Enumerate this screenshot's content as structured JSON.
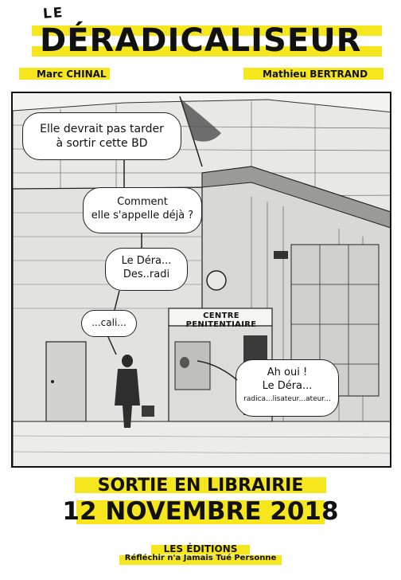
{
  "title": {
    "prefix": "LE",
    "main": "DÉRADICALISEUR"
  },
  "authors": {
    "writer": "Marc CHINAL",
    "artist": "Mathieu BERTRAND"
  },
  "panel": {
    "sign": "CENTRE PENITENTIAIRE",
    "bubbles": [
      {
        "lines": [
          "Elle devrait pas tarder",
          "à sortir cette BD"
        ]
      },
      {
        "lines": [
          "Comment",
          "elle s'appelle déjà ?"
        ]
      },
      {
        "lines": [
          "Le Déra...",
          "Des..radi"
        ]
      },
      {
        "lines": [
          "...cali..."
        ]
      },
      {
        "lines": [
          "Ah oui !",
          "Le Déra...",
          "radica...lisateur...ateur..."
        ]
      }
    ]
  },
  "release": {
    "line1": "SORTIE EN LIBRAIRIE",
    "line2": "12 NOVEMBRE 2018"
  },
  "publisher": {
    "line1": "LES ÉDITIONS",
    "line2": "Réfléchir n'a Jamais Tué Personne"
  },
  "colors": {
    "highlight": "#f5e61e",
    "ink": "#111111",
    "paper": "#ffffff"
  }
}
